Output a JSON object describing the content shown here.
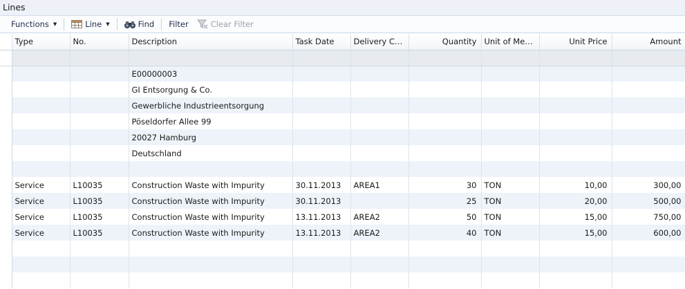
{
  "part": {
    "title": "Lines"
  },
  "toolbar": {
    "functions_label": "Functions",
    "line_label": "Line",
    "find_label": "Find",
    "filter_label": "Filter",
    "clear_filter_label": "Clear Filter"
  },
  "grid": {
    "columns": {
      "type": "Type",
      "no": "No.",
      "description": "Description",
      "task_date": "Task Date",
      "delivery_code": "Delivery Co...",
      "quantity": "Quantity",
      "unit_of_measure": "Unit of Mea...",
      "unit_price": "Unit Price",
      "amount": "Amount"
    },
    "text_rows": [
      {
        "description": "E00000003"
      },
      {
        "description": "GI Entsorgung & Co."
      },
      {
        "description": "Gewerbliche Industrieentsorgung"
      },
      {
        "description": "Pöseldorfer Allee 99"
      },
      {
        "description": "20027 Hamburg"
      },
      {
        "description": "Deutschland"
      }
    ],
    "service_rows": [
      {
        "type": "Service",
        "no": "L10035",
        "description": "Construction Waste with Impurity",
        "task_date": "30.11.2013",
        "delivery_code": "AREA1",
        "quantity": "30",
        "unit_of_measure": "TON",
        "unit_price": "10,00",
        "amount": "300,00"
      },
      {
        "type": "Service",
        "no": "L10035",
        "description": "Construction Waste with Impurity",
        "task_date": "30.11.2013",
        "delivery_code": "",
        "quantity": "25",
        "unit_of_measure": "TON",
        "unit_price": "20,00",
        "amount": "500,00"
      },
      {
        "type": "Service",
        "no": "L10035",
        "description": "Construction Waste with Impurity",
        "task_date": "13.11.2013",
        "delivery_code": "AREA2",
        "quantity": "50",
        "unit_of_measure": "TON",
        "unit_price": "15,00",
        "amount": "750,00"
      },
      {
        "type": "Service",
        "no": "L10035",
        "description": "Construction Waste with Impurity",
        "task_date": "13.11.2013",
        "delivery_code": "AREA2",
        "quantity": "40",
        "unit_of_measure": "TON",
        "unit_price": "15,00",
        "amount": "600,00"
      }
    ]
  },
  "icons": {
    "line": "grid-icon",
    "find": "binoculars-icon",
    "clear_filter": "funnel-clear-icon"
  }
}
